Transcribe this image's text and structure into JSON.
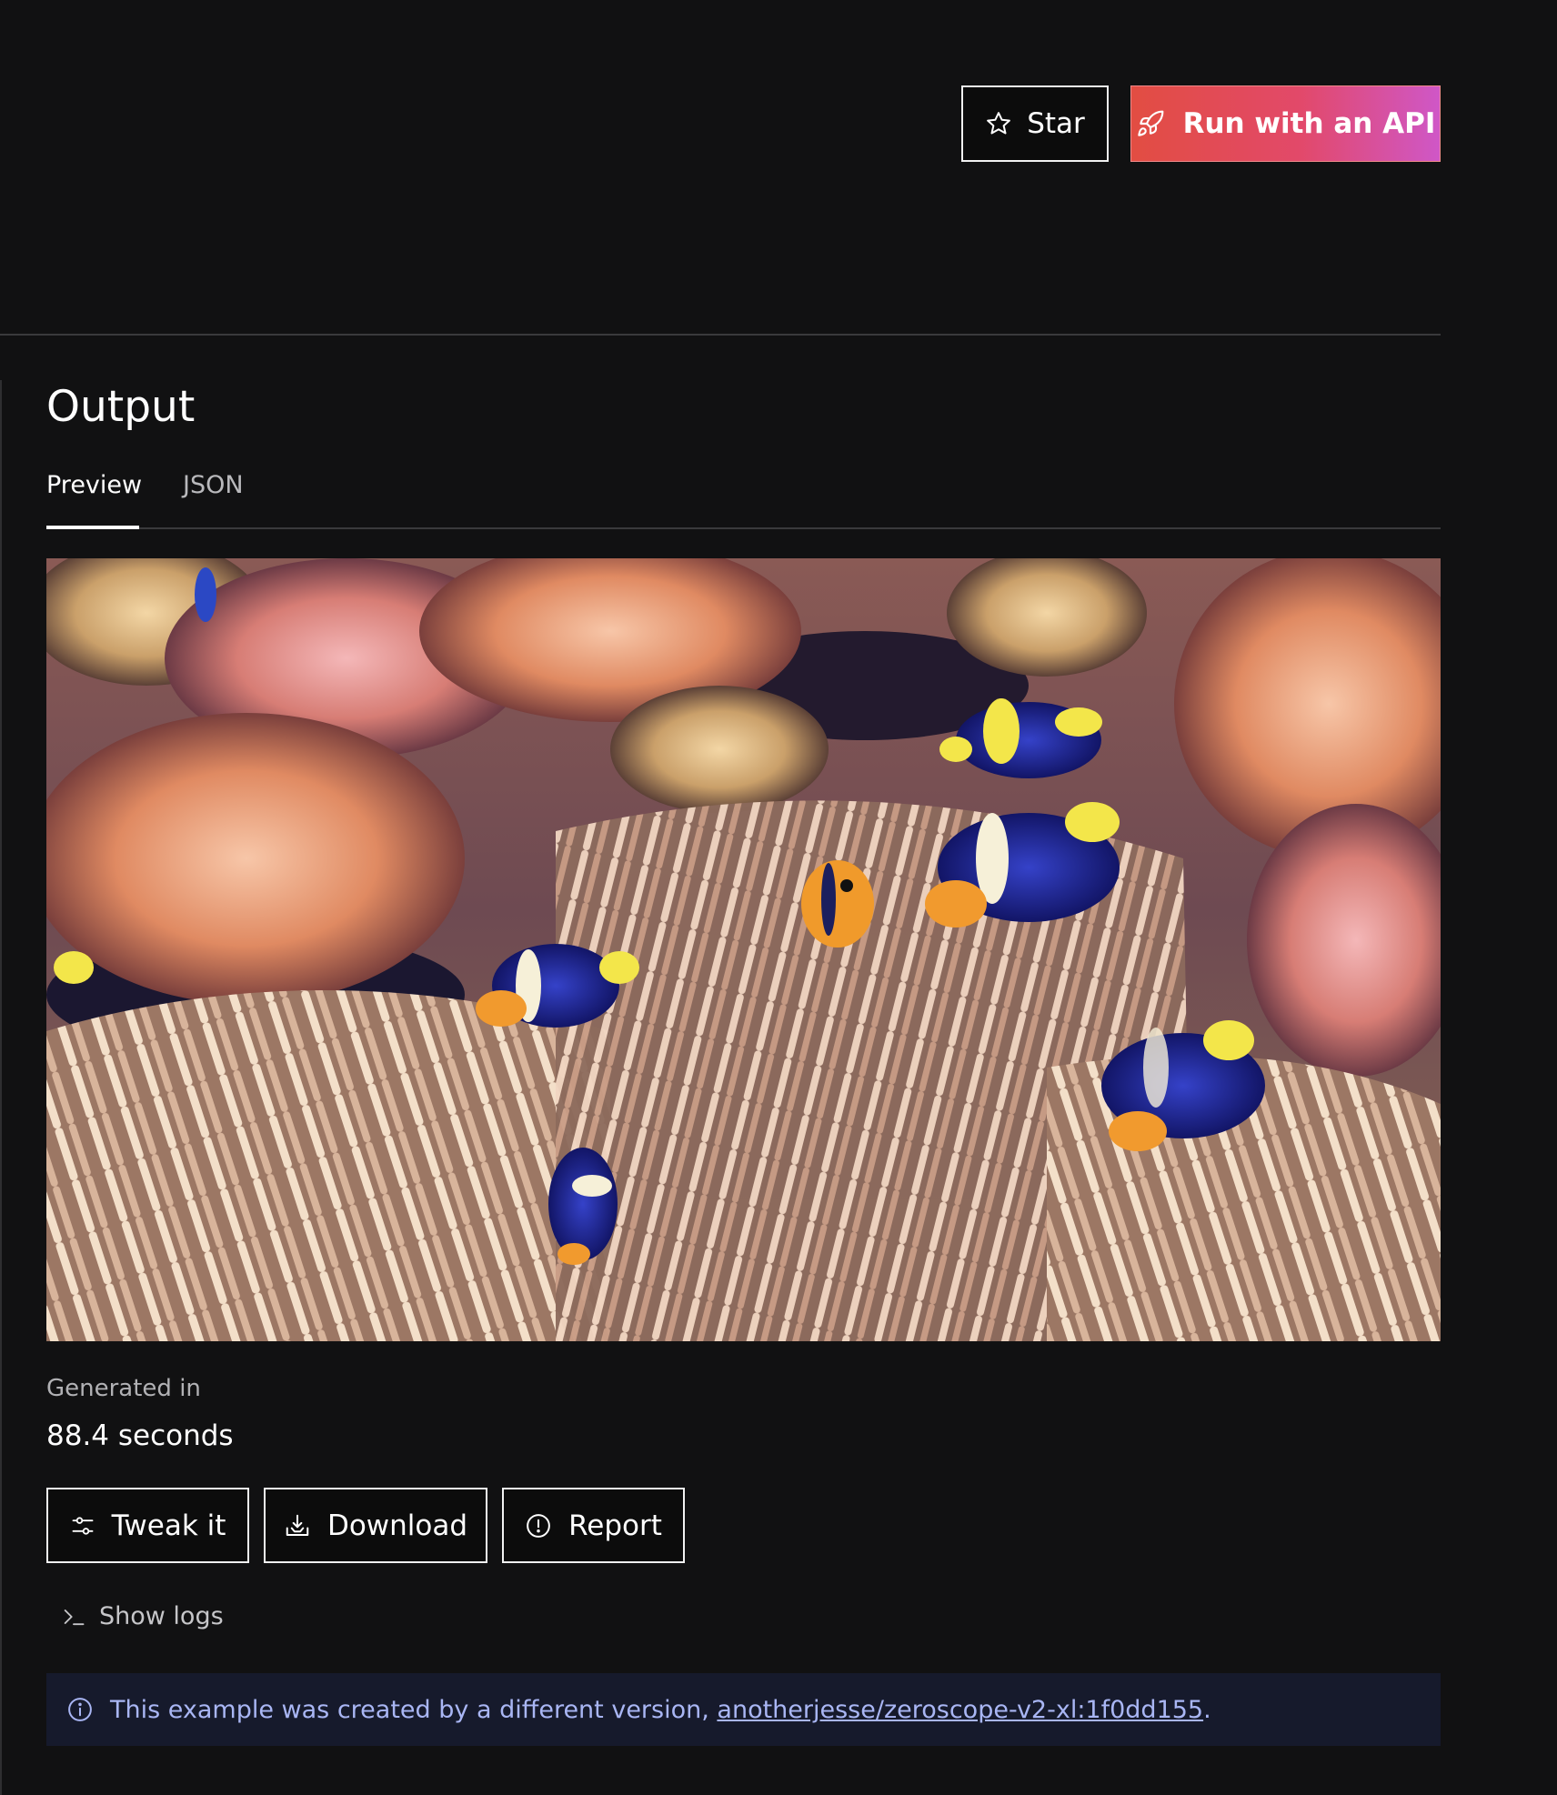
{
  "header": {
    "star_label": "Star",
    "api_label": "Run with an API"
  },
  "output": {
    "title": "Output",
    "tabs": [
      {
        "label": "Preview",
        "active": true
      },
      {
        "label": "JSON",
        "active": false
      }
    ]
  },
  "generated": {
    "label": "Generated in",
    "value": "88.4 seconds"
  },
  "actions": {
    "tweak_label": "Tweak it",
    "download_label": "Download",
    "report_label": "Report",
    "logs_label": "Show logs"
  },
  "notice": {
    "text": "This example was created by a different version, ",
    "link": "anotherjesse/zeroscope-v2-xl:1f0dd155",
    "suffix": "."
  },
  "icons": {
    "star": "star-icon",
    "api": "rocket-icon",
    "tweak": "sliders-icon",
    "download": "download-icon",
    "report": "alert-circle-icon",
    "logs": "terminal-icon",
    "notice": "info-icon"
  },
  "colors": {
    "background": "#111112",
    "api_gradient_start": "#e24d42",
    "api_gradient_end": "#cf57c7",
    "notice_bg": "#161a2c",
    "notice_text": "#a9b6f4"
  }
}
